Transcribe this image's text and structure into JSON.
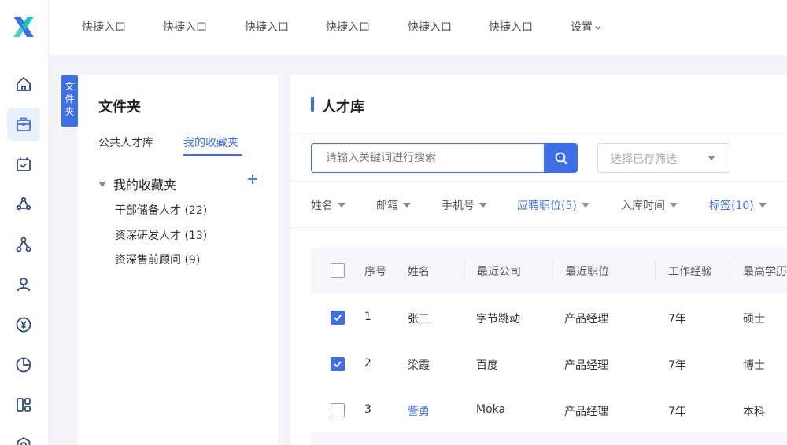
{
  "app": {
    "logo": "x-logo",
    "brand_color": "#3e6fe8"
  },
  "rail": {
    "items": [
      {
        "icon": "home-icon",
        "active": false
      },
      {
        "icon": "briefcase-icon",
        "active": true
      },
      {
        "icon": "calendar-check-icon",
        "active": false
      },
      {
        "icon": "recycle-icon",
        "active": false
      },
      {
        "icon": "org-nodes-icon",
        "active": false
      },
      {
        "icon": "user-icon",
        "active": false
      },
      {
        "icon": "yen-icon",
        "active": false
      },
      {
        "icon": "pie-chart-icon",
        "active": false
      },
      {
        "icon": "layout-icon",
        "active": false
      },
      {
        "icon": "settings-icon",
        "active": false
      }
    ]
  },
  "topnav": {
    "items": [
      "快捷入口",
      "快捷入口",
      "快捷入口",
      "快捷入口",
      "快捷入口",
      "快捷入口"
    ],
    "settings_label": "设置"
  },
  "side_tab": {
    "label": "文件夹"
  },
  "folder_panel": {
    "title": "文件夹",
    "tabs": [
      {
        "label": "公共人才库",
        "active": false
      },
      {
        "label": "我的收藏夹",
        "active": true
      }
    ],
    "tree_root": "我的收藏夹",
    "tree_children": [
      "干部储备人才 (22)",
      "资深研发人才 (13)",
      "资深售前顾问 (9)"
    ]
  },
  "main": {
    "title": "人才库",
    "search_placeholder": "请输入关键词进行搜索",
    "saved_filter_placeholder": "选择已存筛选",
    "column_filters": [
      {
        "label": "姓名",
        "highlight": false
      },
      {
        "label": "邮箱",
        "highlight": false
      },
      {
        "label": "手机号",
        "highlight": false
      },
      {
        "label": "应聘职位(5)",
        "highlight": true
      },
      {
        "label": "入库时间",
        "highlight": false
      },
      {
        "label": "标签(10)",
        "highlight": true
      }
    ],
    "table": {
      "headers": [
        "序号",
        "姓名",
        "最近公司",
        "最近职位",
        "工作经验",
        "最高学历"
      ],
      "rows": [
        {
          "checked": true,
          "cells": [
            "1",
            "张三",
            "字节跳动",
            "产品经理",
            "7年",
            "硕士"
          ],
          "name_link": false
        },
        {
          "checked": true,
          "cells": [
            "2",
            "梁霞",
            "百度",
            "产品经理",
            "7年",
            "博士"
          ],
          "name_link": false
        },
        {
          "checked": false,
          "cells": [
            "3",
            "訾勇",
            "Moka",
            "产品经理",
            "7年",
            "本科"
          ],
          "name_link": true
        }
      ]
    }
  }
}
